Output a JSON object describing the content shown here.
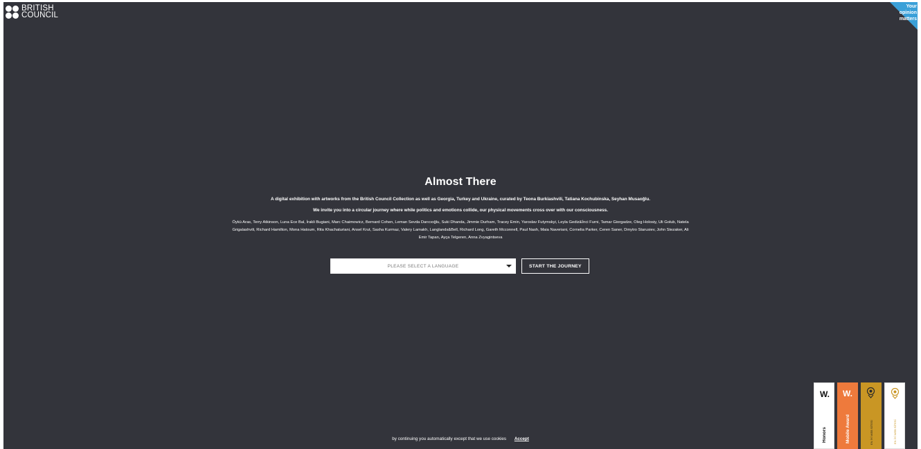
{
  "header": {
    "logo_line1": "BRITISH",
    "logo_line2": "COUNCIL",
    "feedback_line1": "Your",
    "feedback_line2": "opinion",
    "feedback_line3": "matters"
  },
  "main": {
    "title": "Almost There",
    "description": "A digital exhibition with artworks from the British Council Collection as well as Georgia, Turkey and Ukraine, curated by Teona Burkiashvili, Tatiana Kochubinska, Seyhan Musaoğlu.",
    "invite": "We invite you into a circular journey where while politics and emotions collide, our physical movements cross over with our consciousness.",
    "artists": "Öykü Aras, Terry Atkinson, Luna Ece Bal, İrakli Bugiani, Marc Chaimowicz, Bernard Cohen, Leman Sevda Darıcıoğlu, Suki Dhanda, Jimmie Durham, Tracey Emin, Yaroslav Futymskyi, Leyla Gediz&İnci Furni, Tamar Giorgadze, Oleg Holosiy, Uli Golub, Natela Grigalashvili, Richard Hamilton, Mona Hatoum, Rita Khachaturiani, Ansel Krut, Sasha Kurmaz, Valery Lamakh, Langlands&Bell, Richard Long, Gareth Mcconnell, Paul Nash, Maia Naveriani, Cornelia Parker, Ceren Saner, Dmytro Starusiev, John Stezaker, Ali Emir Tapan, Ayça Telgeren, Anna Zvyagintseva",
    "language_select": "PLEASE SELECT A LANGUAGE",
    "start_button": "START THE JOURNEY"
  },
  "cookie": {
    "text": "by continuing you automatically except that we use cookies",
    "accept": "Accept"
  },
  "awards": [
    {
      "top": "W.",
      "label": "Honors"
    },
    {
      "top": "W.",
      "label": "Mobile Award"
    },
    {
      "label": "EN İYİ WEB SİTESİ"
    },
    {
      "label": "EN İYİ WEB SİTESİ"
    }
  ],
  "colors": {
    "background": "#33343b",
    "feedback": "#3aa0d8",
    "mobile_award": "#ee7a3c",
    "gold_award": "#c99624"
  }
}
